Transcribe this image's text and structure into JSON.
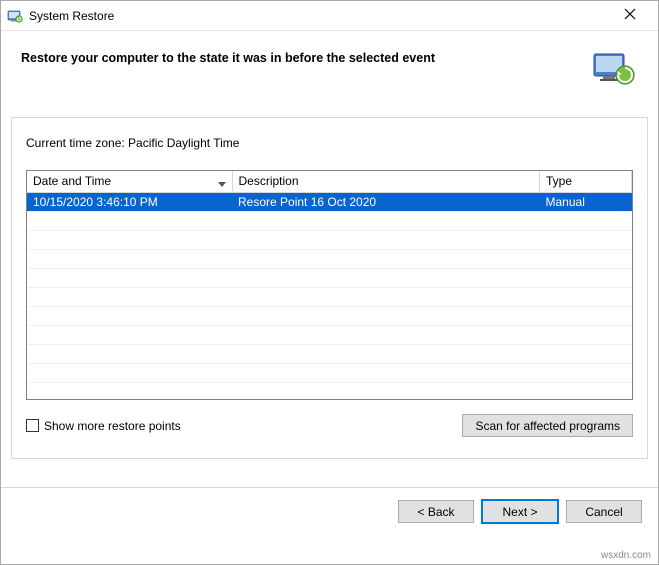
{
  "window": {
    "title": "System Restore",
    "close_icon": "close-icon"
  },
  "header": {
    "heading": "Restore your computer to the state it was in before the selected event"
  },
  "timezone_label": "Current time zone: Pacific Daylight Time",
  "table": {
    "columns": {
      "datetime": "Date and Time",
      "description": "Description",
      "type": "Type"
    },
    "rows": [
      {
        "datetime": "10/15/2020 3:46:10 PM",
        "description": "Resore Point 16 Oct 2020",
        "type": "Manual",
        "selected": true
      }
    ],
    "empty_row_count": 10
  },
  "checkbox": {
    "label": "Show more restore points",
    "checked": false
  },
  "scan_button": "Scan for affected programs",
  "nav": {
    "back": "< Back",
    "next": "Next >",
    "cancel": "Cancel"
  },
  "watermark": "wsxdn.com"
}
